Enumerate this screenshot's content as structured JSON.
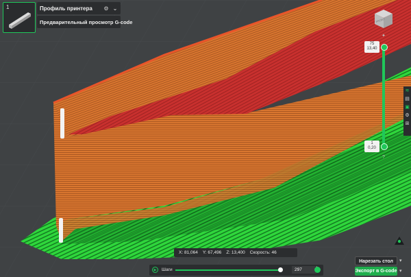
{
  "plate": {
    "number": "1"
  },
  "header": {
    "profile_label": "Профиль принтера",
    "preview_label": "Предварительный просмотр G-code"
  },
  "view_cube": {
    "face_label": "FRONT"
  },
  "layer_slider": {
    "top_layer": "75",
    "top_height": "13,40",
    "bottom_layer": "1",
    "bottom_height": "0,20",
    "help_glyph": "?"
  },
  "tools": [
    "layers-icon",
    "ruler-icon",
    "cube-icon",
    "gear-icon",
    "grid-icon"
  ],
  "coords": {
    "x": "X: 81,064",
    "y": "Y: 67,496",
    "z": "Z: 13,400",
    "speed": "Скорость: 46"
  },
  "steps": {
    "label": "Шаги",
    "value": "297",
    "progress": 0.92
  },
  "actions": {
    "slice": "Нарезать стол",
    "export": "Экспорт в G-code"
  },
  "colors": {
    "accent": "#1fc75a",
    "wall": "#d9762f",
    "top_surface": "#c8302e",
    "support": "#33d43f",
    "background": "#3f4244"
  }
}
